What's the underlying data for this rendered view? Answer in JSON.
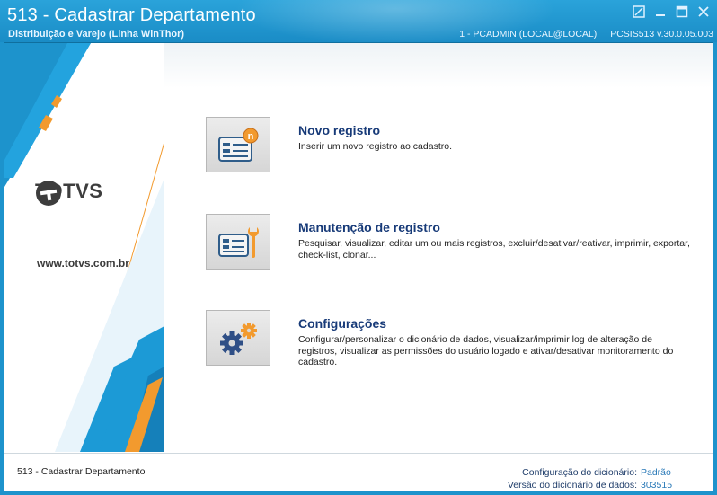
{
  "window": {
    "title": "513 - Cadastrar Departamento",
    "subtitle": "Distribuição e Varejo (Linha WinThor)",
    "connection": "1 - PCADMIN (LOCAL@LOCAL)",
    "version": "PCSIS513  v.30.0.05.003"
  },
  "brand": {
    "logo_text": "TOTVS",
    "website": "www.totvs.com.br"
  },
  "options": [
    {
      "title": "Novo registro",
      "description": "Inserir um novo registro ao cadastro.",
      "icon": "new-record-icon"
    },
    {
      "title": "Manutenção de registro",
      "description": "Pesquisar, visualizar, editar um ou mais registros, excluir/desativar/reativar, imprimir, exportar, check-list,  clonar...",
      "icon": "maintenance-icon"
    },
    {
      "title": "Configurações",
      "description": "Configurar/personalizar o dicionário de dados, visualizar/imprimir log de alteração de registros, visualizar as permissões do usuário logado e ativar/desativar monitoramento do cadastro.",
      "icon": "settings-gears-icon"
    }
  ],
  "status": {
    "routine": "513 - Cadastrar Departamento",
    "dictionary_config_label": "Configuração do dicionário:",
    "dictionary_config_value": "Padrão",
    "dictionary_version_label": "Versão do dicionário de dados:",
    "dictionary_version_value": "303515"
  },
  "colors": {
    "title_bar": "#1d93cc",
    "accent_orange": "#f29a2e",
    "accent_blue": "#1c9ad6",
    "option_title": "#173a78"
  }
}
